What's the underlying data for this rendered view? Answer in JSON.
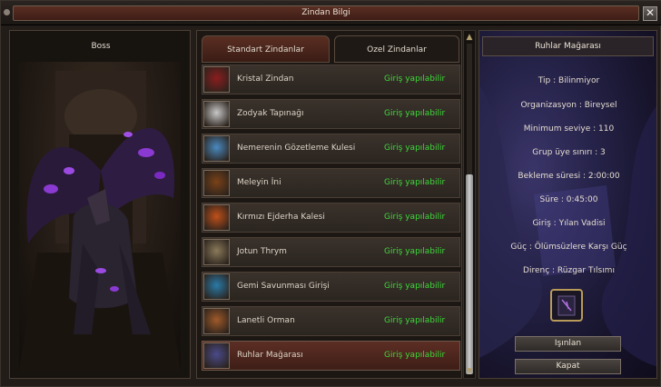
{
  "window": {
    "title": "Zindan Bilgi",
    "close_symbol": "✕"
  },
  "boss": {
    "label": "Boss"
  },
  "tabs": [
    {
      "label": "Standart Zindanlar",
      "active": true
    },
    {
      "label": "Ozel Zindanlar",
      "active": false
    }
  ],
  "dungeons": [
    {
      "name": "Kristal Zindan",
      "status": "Giriş yapılabilir",
      "thumb_color": "#8b1e1e"
    },
    {
      "name": "Zodyak Tapınağı",
      "status": "Giriş yapılabilir",
      "thumb_color": "#c8c8c8"
    },
    {
      "name": "Nemerenin Gözetleme Kulesi",
      "status": "Giriş yapılabilir",
      "thumb_color": "#4a8ac0"
    },
    {
      "name": "Meleyin İni",
      "status": "Giriş yapılabilir",
      "thumb_color": "#7a4218"
    },
    {
      "name": "Kırmızı Ejderha Kalesi",
      "status": "Giriş yapılabilir",
      "thumb_color": "#c0501a"
    },
    {
      "name": "Jotun Thrym",
      "status": "Giriş yapılabilir",
      "thumb_color": "#8a7a5a"
    },
    {
      "name": "Gemi Savunması Girişi",
      "status": "Giriş yapılabilir",
      "thumb_color": "#2a7aa8"
    },
    {
      "name": "Lanetli Orman",
      "status": "Giriş yapılabilir",
      "thumb_color": "#a05a2a"
    },
    {
      "name": "Ruhlar Mağarası",
      "status": "Giriş yapılabilir",
      "thumb_color": "#4a4a8a",
      "selected": true
    }
  ],
  "info": {
    "title": "Ruhlar Mağarası",
    "lines": [
      "Tip : Bilinmiyor",
      "Organizasyon : Bireysel",
      "Minimum seviye : 110",
      "Grup üye sınırı : 3",
      "Bekleme süresi : 2:00:00",
      "Süre : 0:45:00",
      "Giriş : Yılan Vadisi",
      "Güç : Ölümsüzlere Karşı Güç",
      "Direnç : Rüzgar Tılsımı"
    ],
    "item_icon": "spellbook-icon",
    "teleport_button": "Işınlan",
    "close_button": "Kapat"
  },
  "colors": {
    "status_green": "#3dd93a",
    "accent_red": "#5a2e22",
    "item_border_gold": "#b89a5a"
  }
}
